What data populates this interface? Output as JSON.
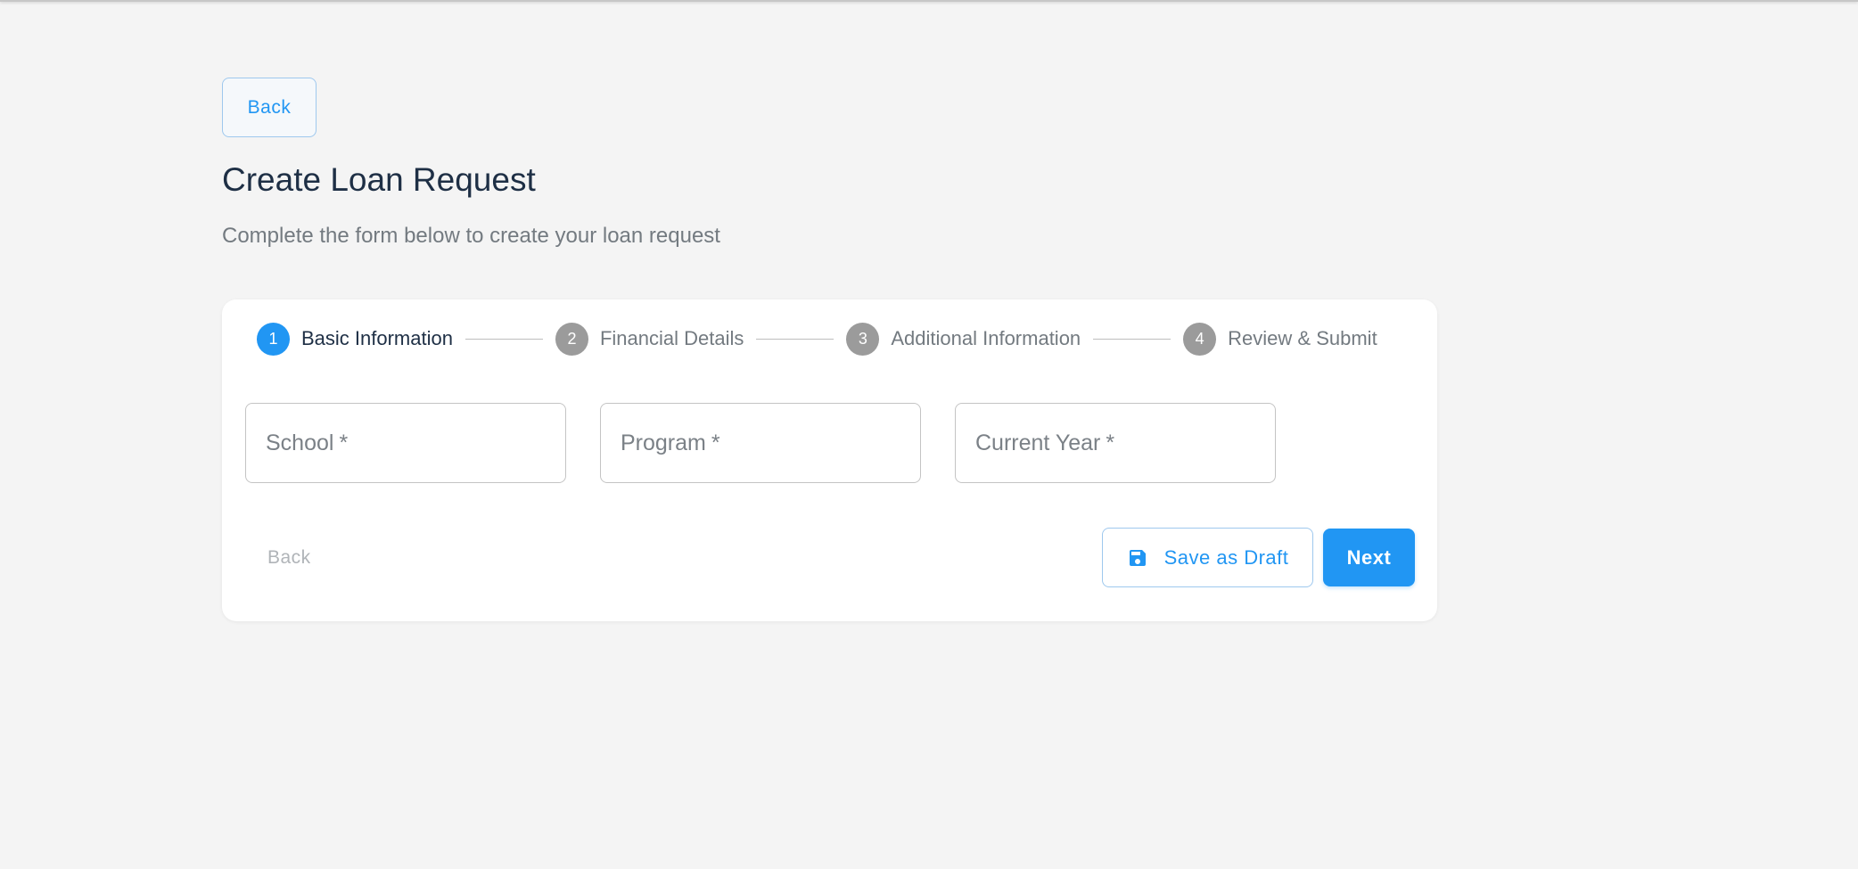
{
  "header": {
    "back_label": "Back",
    "title": "Create Loan Request",
    "subtitle": "Complete the form below to create your loan request"
  },
  "stepper": {
    "active_step": 1,
    "steps": [
      {
        "number": "1",
        "label": "Basic Information"
      },
      {
        "number": "2",
        "label": "Financial Details"
      },
      {
        "number": "3",
        "label": "Additional Information"
      },
      {
        "number": "4",
        "label": "Review & Submit"
      }
    ]
  },
  "form": {
    "fields": [
      {
        "label": "School",
        "required_mark": "*",
        "value": ""
      },
      {
        "label": "Program",
        "required_mark": "*",
        "value": ""
      },
      {
        "label": "Current Year",
        "required_mark": "*",
        "value": ""
      }
    ]
  },
  "actions": {
    "back_label": "Back",
    "save_draft_label": "Save as Draft",
    "save_draft_icon": "floppy-disk-icon",
    "next_label": "Next"
  },
  "colors": {
    "accent": "#2196f3",
    "background": "#f4f4f4",
    "inactive_step": "#9b9b9b"
  }
}
